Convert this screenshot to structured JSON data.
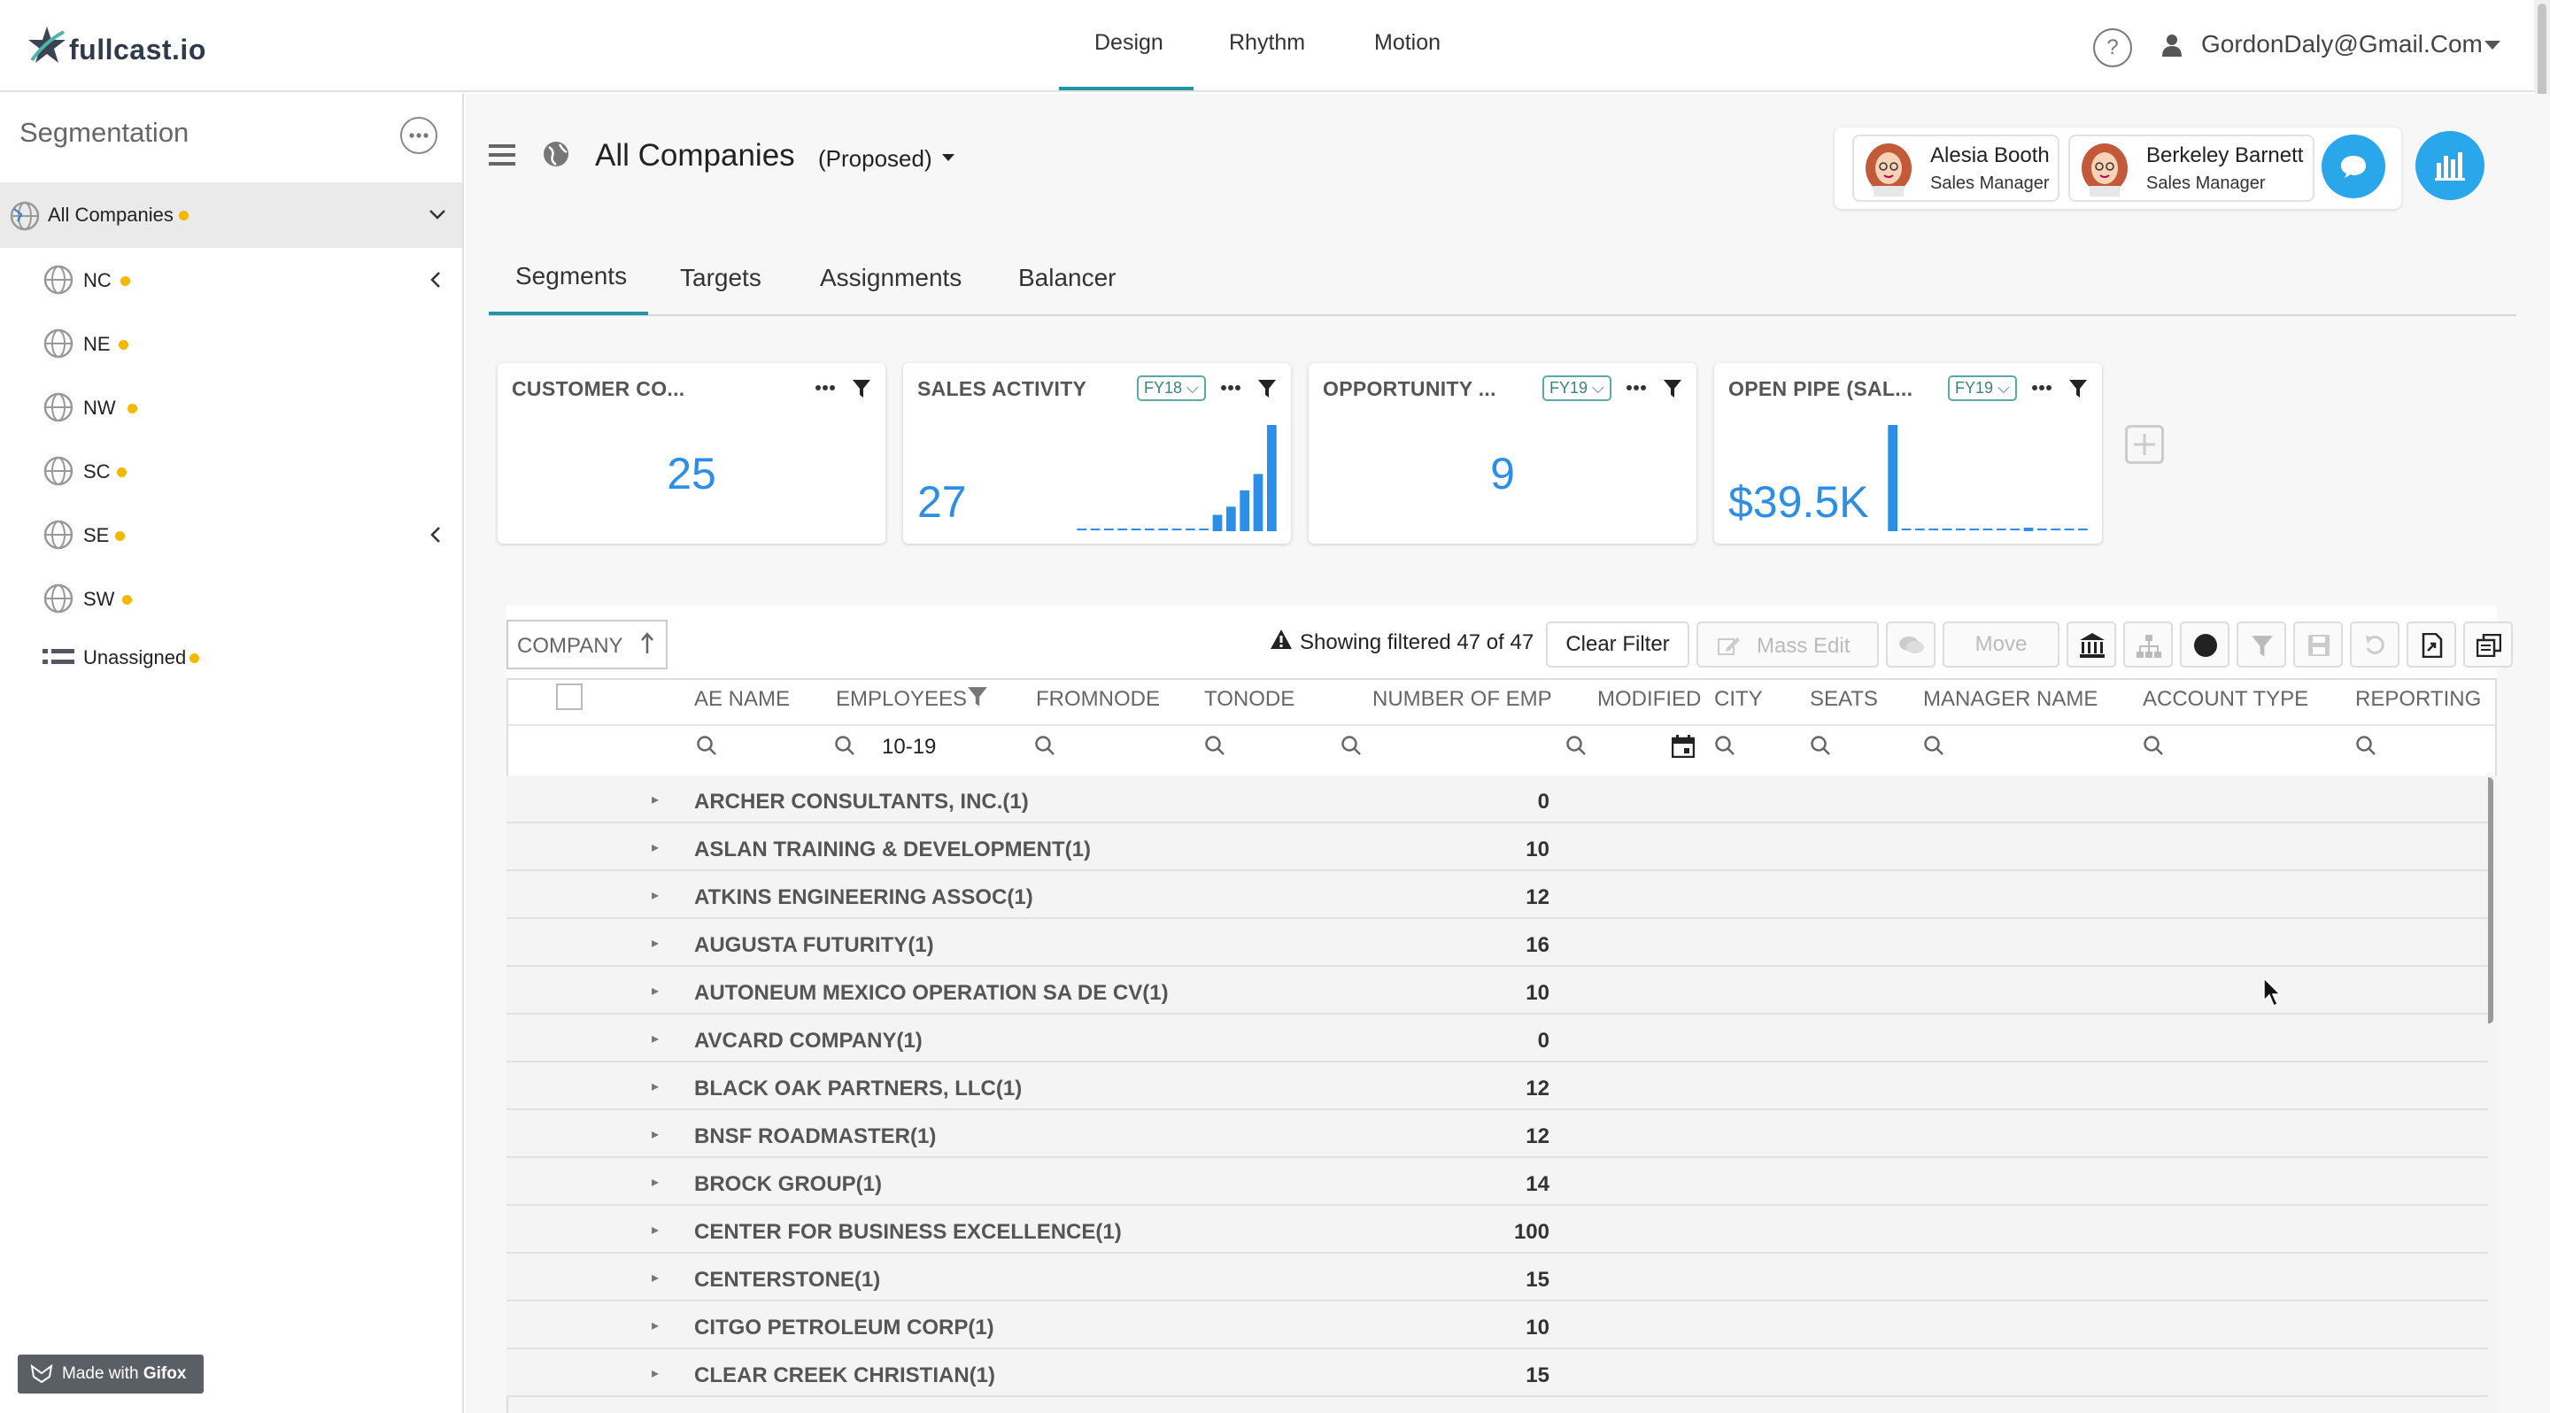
{
  "app": {
    "logo_text": "fullcast.io"
  },
  "nav": {
    "links": [
      "Design",
      "Rhythm",
      "Motion"
    ],
    "help_label": "?",
    "user_email": "GordonDaly@Gmail.Com"
  },
  "sidebar": {
    "title": "Segmentation",
    "selected": "All Companies",
    "items": [
      {
        "label": "NC",
        "has_arrow": true
      },
      {
        "label": "NE",
        "has_arrow": false
      },
      {
        "label": "NW",
        "has_arrow": false
      },
      {
        "label": "SC",
        "has_arrow": false
      },
      {
        "label": "SE",
        "has_arrow": true
      },
      {
        "label": "SW",
        "has_arrow": false
      }
    ],
    "unassigned": "Unassigned",
    "gifox_label": "Made with ",
    "gifox_brand": "Gifox"
  },
  "header": {
    "title": "All Companies",
    "subtitle": "(Proposed)",
    "people": [
      {
        "name": "Alesia Booth",
        "role": "Sales Manager"
      },
      {
        "name": "Berkeley Barnett",
        "role": "Sales Manager"
      }
    ]
  },
  "tabs": [
    "Segments",
    "Targets",
    "Assignments",
    "Balancer"
  ],
  "cards": [
    {
      "title": "CUSTOMER CO...",
      "value": "25",
      "badge": ""
    },
    {
      "title": "SALES ACTIVITY",
      "value": "27",
      "badge": "FY18"
    },
    {
      "title": "OPPORTUNITY ...",
      "value": "9",
      "badge": "FY19"
    },
    {
      "title": "OPEN PIPE (SAL...",
      "value": "$39.5K",
      "badge": "FY19"
    }
  ],
  "sparklines": {
    "sales_activity": [
      0,
      0,
      0,
      0,
      0,
      0,
      0,
      0,
      0,
      0,
      2,
      3,
      5,
      7,
      13
    ],
    "open_pipe": [
      13,
      0,
      0,
      0,
      0,
      0,
      0,
      0,
      0,
      0,
      0.3,
      0,
      0,
      0,
      0
    ]
  },
  "grid": {
    "sort_label": "COMPANY",
    "filter_status": "Showing filtered 47 of 47",
    "clear_filter": "Clear Filter",
    "mass_edit": "Mass Edit",
    "move": "Move",
    "columns": [
      "AE NAME",
      "EMPLOYEES",
      "FROMNODE",
      "TONODE",
      "NUMBER OF EMP",
      "MODIFIED",
      "CITY",
      "SEATS",
      "MANAGER NAME",
      "ACCOUNT TYPE",
      "REPORTING I"
    ],
    "employees_filter_value": "10-19",
    "rows": [
      {
        "name": "ARCHER CONSULTANTS, INC.(1)",
        "num": "0"
      },
      {
        "name": "ASLAN TRAINING & DEVELOPMENT(1)",
        "num": "10"
      },
      {
        "name": "ATKINS ENGINEERING ASSOC(1)",
        "num": "12"
      },
      {
        "name": "AUGUSTA FUTURITY(1)",
        "num": "16"
      },
      {
        "name": "AUTONEUM MEXICO OPERATION SA DE CV(1)",
        "num": "10"
      },
      {
        "name": "AVCARD COMPANY(1)",
        "num": "0"
      },
      {
        "name": "BLACK OAK PARTNERS, LLC(1)",
        "num": "12"
      },
      {
        "name": "BNSF ROADMASTER(1)",
        "num": "12"
      },
      {
        "name": "BROCK GROUP(1)",
        "num": "14"
      },
      {
        "name": "CENTER FOR BUSINESS EXCELLENCE(1)",
        "num": "100"
      },
      {
        "name": "CENTERSTONE(1)",
        "num": "15"
      },
      {
        "name": "CITGO PETROLEUM CORP(1)",
        "num": "10"
      },
      {
        "name": "CLEAR CREEK CHRISTIAN(1)",
        "num": "15"
      }
    ]
  },
  "colors": {
    "accent": "#2196a6",
    "blue": "#2c8ee6",
    "dot": "#f5b800"
  }
}
